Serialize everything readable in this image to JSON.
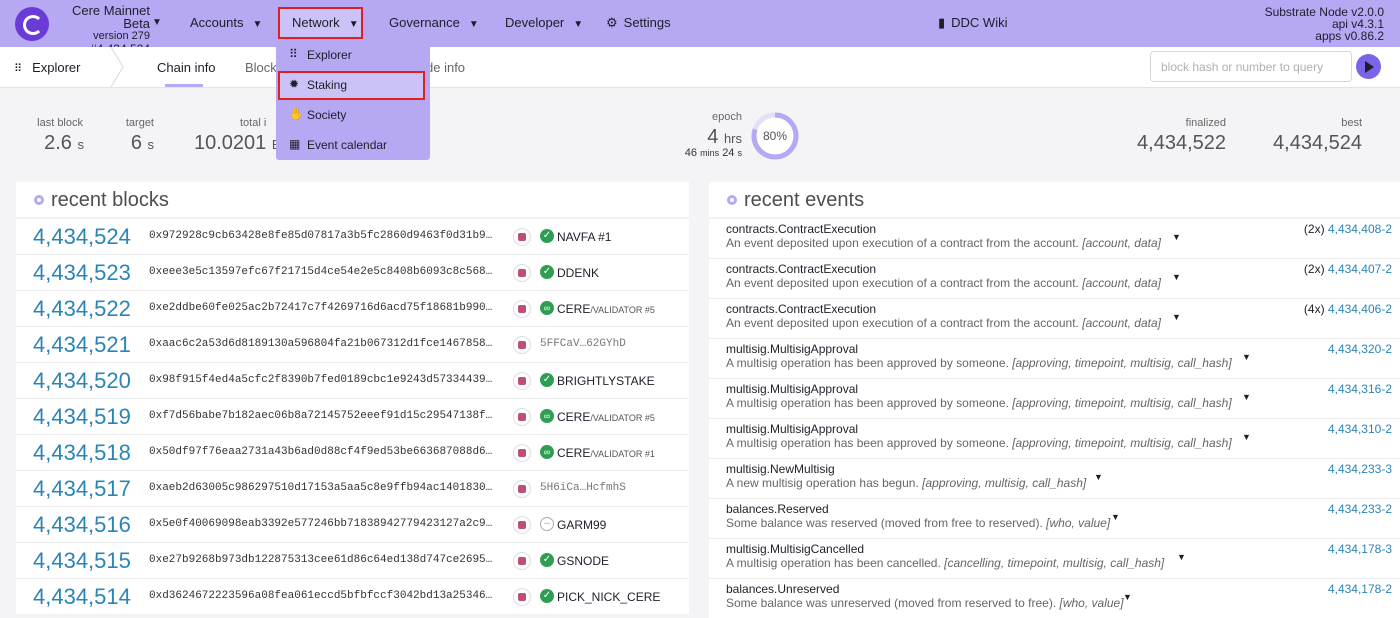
{
  "header": {
    "chain_name": "Cere Mainnet Beta",
    "version": "version 279",
    "block": "#4,434,524",
    "nav": [
      {
        "label": "Accounts"
      },
      {
        "label": "Network"
      },
      {
        "label": "Governance"
      },
      {
        "label": "Developer"
      },
      {
        "label": "Settings"
      }
    ],
    "wiki": "DDC Wiki",
    "node_name": "Substrate Node v2.0.0",
    "api_version": "api v4.3.1",
    "apps_version": "apps v0.86.2"
  },
  "subnav": {
    "section": "Explorer",
    "tabs": [
      {
        "label": "Chain info"
      },
      {
        "label": "Block"
      },
      {
        "label": "de info"
      }
    ],
    "search_placeholder": "block hash or number to query"
  },
  "dropdown": {
    "items": [
      {
        "label": "Explorer",
        "icon": "grid-icon"
      },
      {
        "label": "Staking",
        "icon": "certificate-icon"
      },
      {
        "label": "Society",
        "icon": "hand-icon"
      },
      {
        "label": "Event calendar",
        "icon": "calendar-icon"
      }
    ]
  },
  "summary": {
    "last_block_label": "last block",
    "last_block_value": "2.6",
    "last_block_unit": "s",
    "target_label": "target",
    "target_value": "6",
    "target_unit": "s",
    "total_label": "total i",
    "total_value": "10.0201",
    "total_unit": "B",
    "epoch_label": "epoch",
    "epoch_value": "4",
    "epoch_unit": "hrs",
    "epoch_sub_mins": "46",
    "epoch_sub_mins_unit": "mins",
    "epoch_sub_secs": "24",
    "epoch_sub_secs_unit": "s",
    "epoch_progress": 0.8,
    "epoch_percent": "80%",
    "finalized_label": "finalized",
    "finalized_value": "4,434,522",
    "best_label": "best",
    "best_value": "4,434,524"
  },
  "recent_blocks": {
    "title": "recent blocks",
    "rows": [
      {
        "number": "4,434,524",
        "hash": "0x972928c9cb63428e8fe85d07817a3b5fc2860d9463f0d31b92…",
        "author": "NAVFA #1",
        "author_sub": "",
        "verified": "check"
      },
      {
        "number": "4,434,523",
        "hash": "0xeee3e5c13597efc67f21715d4ce54e2e5c8408b6093c8c5688…",
        "author": "DDENK",
        "author_sub": "",
        "verified": "check"
      },
      {
        "number": "4,434,522",
        "hash": "0xe2ddbe60fe025ac2b72417c7f4269716d6acd75f18681b9902…",
        "author": "CERE",
        "author_sub": "/VALIDATOR #5",
        "verified": "link"
      },
      {
        "number": "4,434,521",
        "hash": "0xaac6c2a53d6d8189130a596804fa21b067312d1fce1467858c…",
        "author": "5FFCaV…62GYhD",
        "author_sub": "",
        "verified": "none"
      },
      {
        "number": "4,434,520",
        "hash": "0x98f915f4ed4a5cfc2f8390b7fed0189cbc1e9243d57334439e…",
        "author": "BRIGHTLYSTAKE",
        "author_sub": "",
        "verified": "check"
      },
      {
        "number": "4,434,519",
        "hash": "0xf7d56babe7b182aec06b8a72145752eeef91d15c29547138fd…",
        "author": "CERE",
        "author_sub": "/VALIDATOR #5",
        "verified": "link"
      },
      {
        "number": "4,434,518",
        "hash": "0x50df97f76eaa2731a43b6ad0d88cf4f9ed53be663687088d6c…",
        "author": "CERE",
        "author_sub": "/VALIDATOR #1",
        "verified": "link"
      },
      {
        "number": "4,434,517",
        "hash": "0xaeb2d63005c986297510d17153a5aa5c8e9ffb94ac1401830a…",
        "author": "5H6iCa…HcfmhS",
        "author_sub": "",
        "verified": "none"
      },
      {
        "number": "4,434,516",
        "hash": "0x5e0f40069098eab3392e577246bb71838942779423127a2c98…",
        "author": "GARM99",
        "author_sub": "",
        "verified": "minus"
      },
      {
        "number": "4,434,515",
        "hash": "0xe27b9268b973db122875313cee61d86c64ed138d747ce2695c…",
        "author": "GSNODE",
        "author_sub": "",
        "verified": "check"
      },
      {
        "number": "4,434,514",
        "hash": "0xd3624672223596a08fea061eccd5bfbfccf3042bd13a25346e…",
        "author": "PICK_NICK_CERE",
        "author_sub": "",
        "verified": "check"
      }
    ]
  },
  "recent_events": {
    "title": "recent events",
    "rows": [
      {
        "event": "contracts.ContractExecution",
        "desc": "An event deposited upon execution of a contract from the account.",
        "args": "[account, data]",
        "count": "(2x)",
        "block": "4,434,408-2"
      },
      {
        "event": "contracts.ContractExecution",
        "desc": "An event deposited upon execution of a contract from the account.",
        "args": "[account, data]",
        "count": "(2x)",
        "block": "4,434,407-2"
      },
      {
        "event": "contracts.ContractExecution",
        "desc": "An event deposited upon execution of a contract from the account.",
        "args": "[account, data]",
        "count": "(4x)",
        "block": "4,434,406-2"
      },
      {
        "event": "multisig.MultisigApproval",
        "desc": "A multisig operation has been approved by someone.",
        "args": "[approving, timepoint, multisig, call_hash]",
        "count": "",
        "block": "4,434,320-2"
      },
      {
        "event": "multisig.MultisigApproval",
        "desc": "A multisig operation has been approved by someone.",
        "args": "[approving, timepoint, multisig, call_hash]",
        "count": "",
        "block": "4,434,316-2"
      },
      {
        "event": "multisig.MultisigApproval",
        "desc": "A multisig operation has been approved by someone.",
        "args": "[approving, timepoint, multisig, call_hash]",
        "count": "",
        "block": "4,434,310-2"
      },
      {
        "event": "multisig.NewMultisig",
        "desc": "A new multisig operation has begun.",
        "args": "[approving, multisig, call_hash]",
        "count": "",
        "block": "4,434,233-3"
      },
      {
        "event": "balances.Reserved",
        "desc": "Some balance was reserved (moved from free to reserved).",
        "args": "[who, value]",
        "count": "",
        "block": "4,434,233-2"
      },
      {
        "event": "multisig.MultisigCancelled",
        "desc": "A multisig operation has been cancelled.",
        "args": "[cancelling, timepoint, multisig, call_hash]",
        "count": "",
        "block": "4,434,178-3"
      },
      {
        "event": "balances.Unreserved",
        "desc": "Some balance was unreserved (moved from reserved to free).",
        "args": "[who, value]",
        "count": "",
        "block": "4,434,178-2"
      }
    ]
  }
}
